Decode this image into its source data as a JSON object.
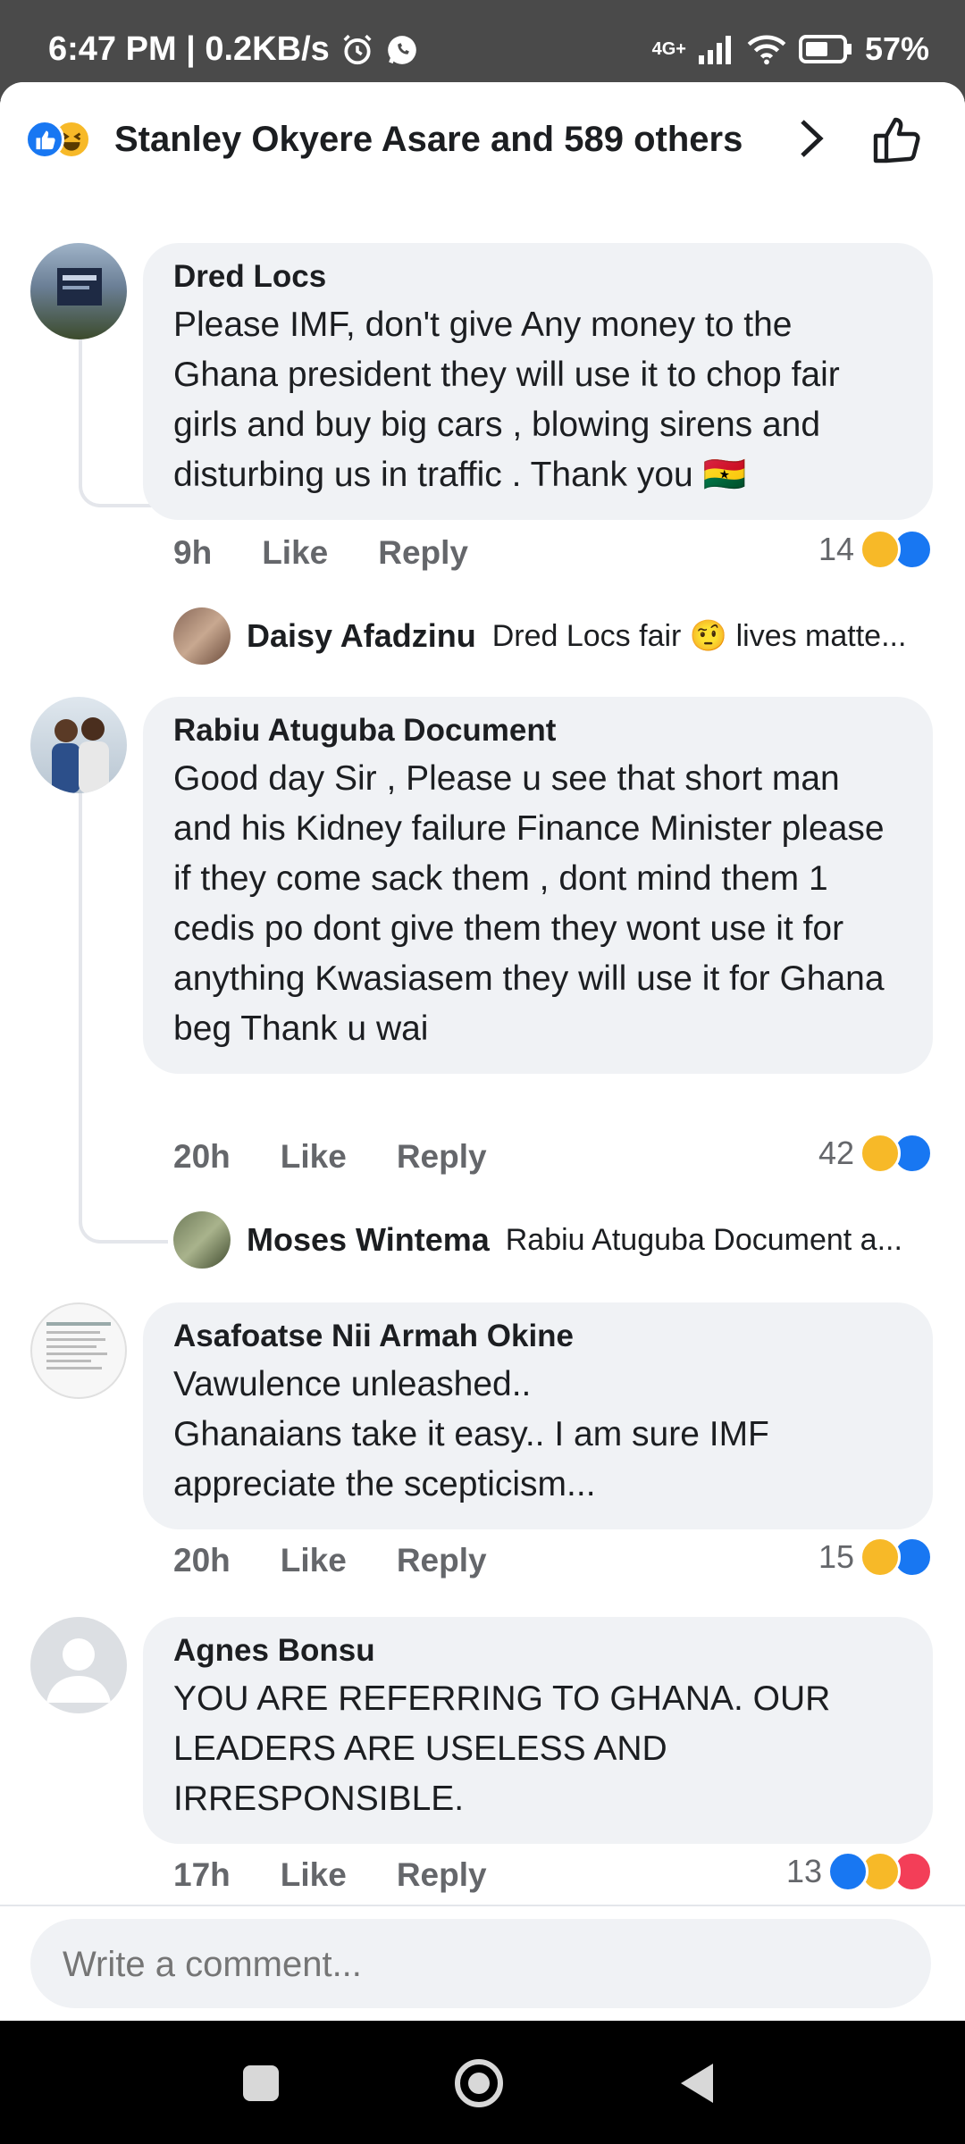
{
  "status_bar": {
    "time": "6:47 PM | 0.2KB/s",
    "network": "4G+",
    "battery": "57%"
  },
  "header": {
    "title": "Stanley Okyere Asare and 589 others"
  },
  "comments": [
    {
      "author": "Dred Locs",
      "text": "Please IMF, don't give Any money to the Ghana president they will use it to chop fair girls and buy big cars , blowing sirens and disturbing us in traffic . Thank you 🇬🇭",
      "time": "9h",
      "like_label": "Like",
      "reply_label": "Reply",
      "reaction_count": "14",
      "reply_preview": {
        "author": "Daisy Afadzinu",
        "snippet": "Dred Locs fair 🤨 lives matte..."
      }
    },
    {
      "author": "Rabiu Atuguba Document",
      "text": "Good day Sir , Please u see that short man and his Kidney failure Finance Minister please if they come sack them , dont mind them 1 cedis po dont give them they wont use it for anything Kwasiasem they will use it for Ghana beg Thank u wai",
      "time": "20h",
      "like_label": "Like",
      "reply_label": "Reply",
      "reaction_count": "42",
      "reply_preview": {
        "author": "Moses Wintema",
        "snippet": "Rabiu Atuguba Document a..."
      }
    },
    {
      "author": "Asafoatse Nii Armah Okine",
      "text": "Vawulence unleashed..\nGhanaians take it easy.. I am sure IMF appreciate the scepticism...",
      "time": "20h",
      "like_label": "Like",
      "reply_label": "Reply",
      "reaction_count": "15"
    },
    {
      "author": "Agnes Bonsu",
      "text": "YOU ARE REFERRING TO GHANA. OUR LEADERS ARE USELESS AND IRRESPONSIBLE.",
      "time": "17h",
      "like_label": "Like",
      "reply_label": "Reply",
      "reaction_count": "13"
    }
  ],
  "composer": {
    "placeholder": "Write a comment..."
  },
  "colors": {
    "like_blue": "#1877f2",
    "haha_yellow": "#f7b928",
    "love_red": "#f33e58",
    "bubble_gray": "#f0f2f5"
  },
  "icons": [
    "alarm-icon",
    "whatsapp-icon",
    "signal-icon",
    "wifi-icon",
    "battery-icon",
    "like-reaction-icon",
    "haha-reaction-icon",
    "love-reaction-icon",
    "chevron-right-icon",
    "thumbs-up-icon",
    "nav-recents-icon",
    "nav-home-icon",
    "nav-back-icon"
  ]
}
